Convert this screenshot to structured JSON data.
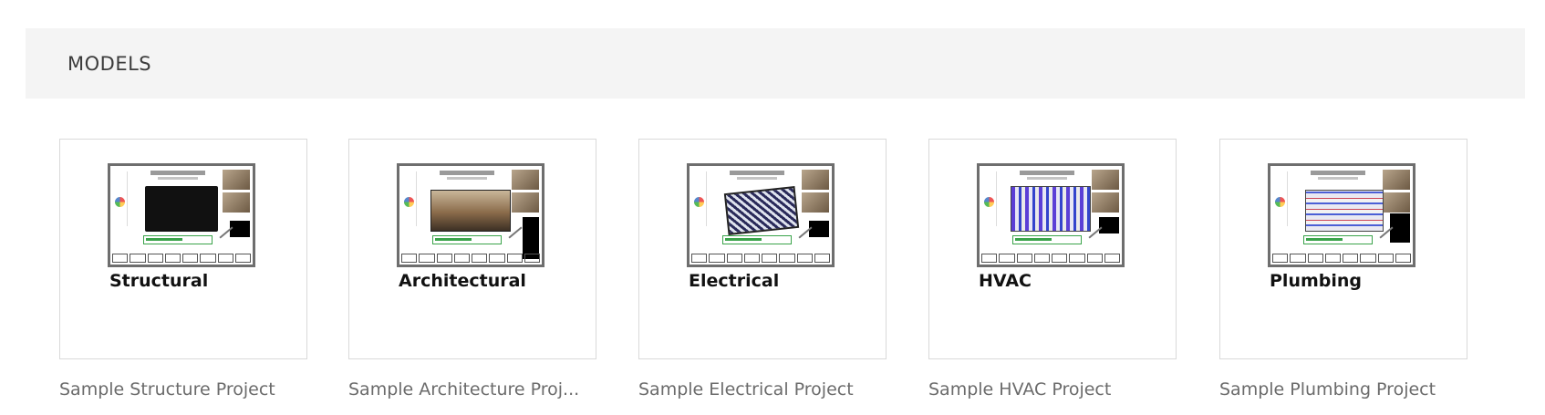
{
  "section": {
    "title": "MODELS"
  },
  "models": [
    {
      "thumbnail_label": "Structural",
      "caption": "Sample Structure Project",
      "plan_style": "structural"
    },
    {
      "thumbnail_label": "Architectural",
      "caption": "Sample Architecture Proj...",
      "plan_style": "architectural"
    },
    {
      "thumbnail_label": "Electrical",
      "caption": "Sample Electrical Project",
      "plan_style": "electrical"
    },
    {
      "thumbnail_label": "HVAC",
      "caption": "Sample HVAC Project",
      "plan_style": "hvac"
    },
    {
      "thumbnail_label": "Plumbing",
      "caption": "Sample Plumbing Project",
      "plan_style": "plumbing"
    }
  ],
  "colors": {
    "header_bg": "#f4f4f4",
    "caption_text": "#6b6b6b",
    "tile_border": "#d9d9d9"
  }
}
